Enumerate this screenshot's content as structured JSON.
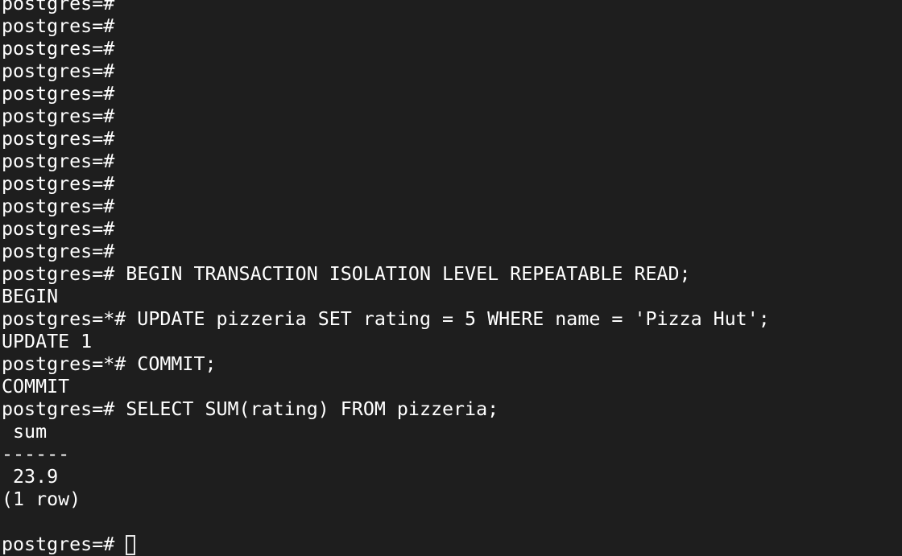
{
  "terminal": {
    "lines": [
      "postgres=#",
      "postgres=#",
      "postgres=#",
      "postgres=#",
      "postgres=#",
      "postgres=#",
      "postgres=#",
      "postgres=#",
      "postgres=#",
      "postgres=#",
      "postgres=#",
      "postgres=#",
      "postgres=# BEGIN TRANSACTION ISOLATION LEVEL REPEATABLE READ;",
      "BEGIN",
      "postgres=*# UPDATE pizzeria SET rating = 5 WHERE name = 'Pizza Hut';",
      "UPDATE 1",
      "postgres=*# COMMIT;",
      "COMMIT",
      "postgres=# SELECT SUM(rating) FROM pizzeria;",
      " sum",
      "------",
      " 23.9",
      "(1 row)",
      ""
    ],
    "prompt": "postgres=# "
  }
}
